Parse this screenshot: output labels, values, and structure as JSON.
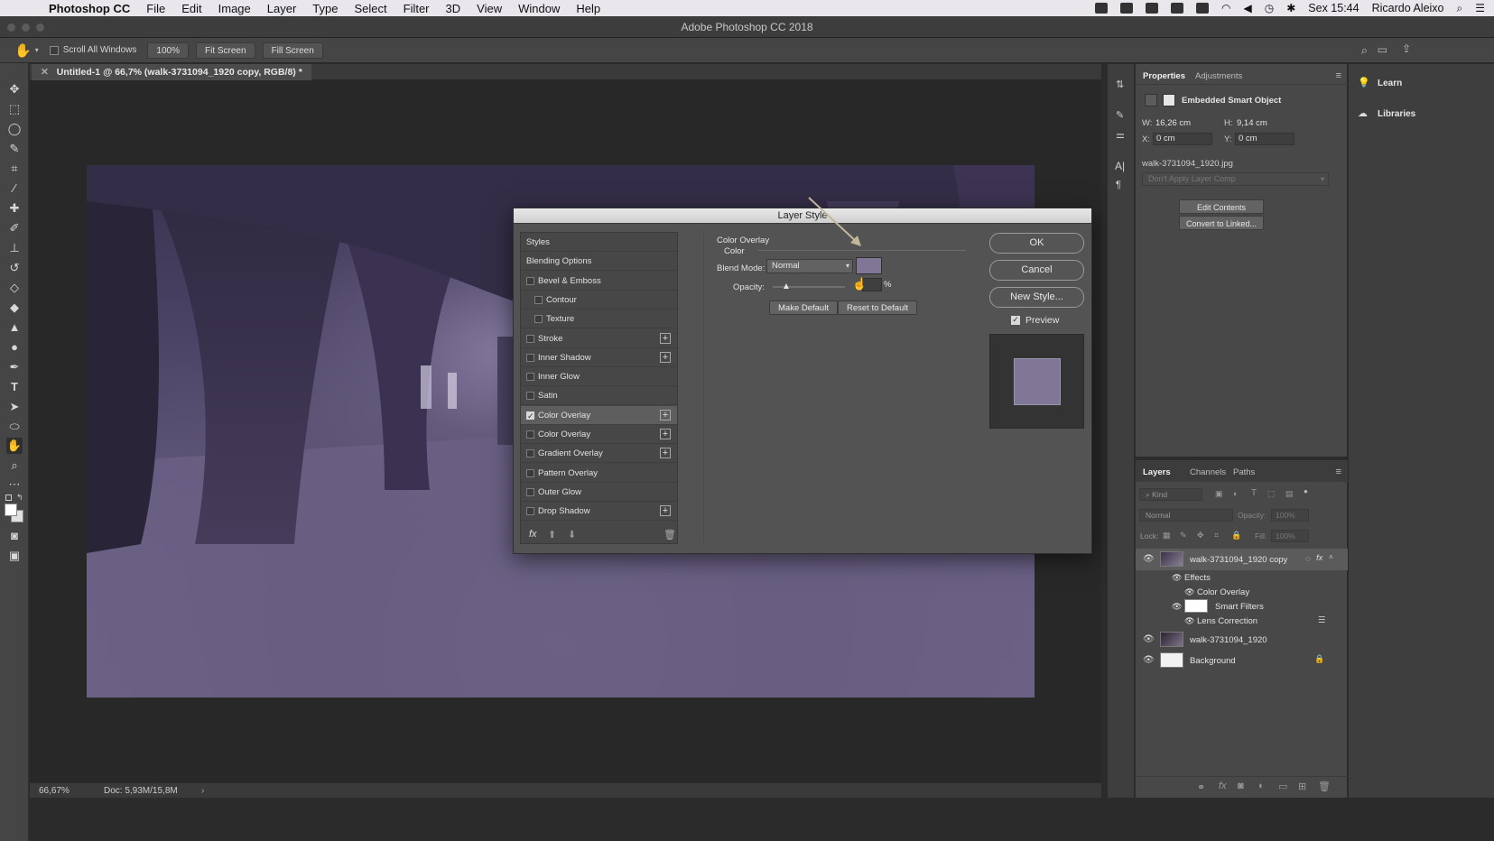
{
  "menubar": {
    "app_name": "Photoshop CC",
    "menus": [
      "File",
      "Edit",
      "Image",
      "Layer",
      "Type",
      "Select",
      "Filter",
      "3D",
      "View",
      "Window",
      "Help"
    ],
    "clock": "Sex 15:44",
    "user": "Ricardo Aleixo"
  },
  "window": {
    "title": "Adobe Photoshop CC 2018"
  },
  "options": {
    "scroll_all_label": "Scroll All Windows",
    "zoom_btn": "100%",
    "fit_screen": "Fit Screen",
    "fill_screen": "Fill Screen"
  },
  "document": {
    "tab_title": "Untitled-1 @ 66,7% (walk-3731094_1920 copy, RGB/8) *",
    "zoom": "66,67%",
    "doc_size": "Doc: 5,93M/15,8M"
  },
  "dialog": {
    "title": "Layer Style",
    "styles": [
      {
        "label": "Styles",
        "type": "header"
      },
      {
        "label": "Blending Options",
        "type": "header"
      },
      {
        "label": "Bevel & Emboss",
        "checked": false
      },
      {
        "label": "Contour",
        "checked": false,
        "indent": true
      },
      {
        "label": "Texture",
        "checked": false,
        "indent": true
      },
      {
        "label": "Stroke",
        "checked": false,
        "plus": true
      },
      {
        "label": "Inner Shadow",
        "checked": false,
        "plus": true
      },
      {
        "label": "Inner Glow",
        "checked": false
      },
      {
        "label": "Satin",
        "checked": false
      },
      {
        "label": "Color Overlay",
        "checked": true,
        "plus": true,
        "selected": true
      },
      {
        "label": "Color Overlay",
        "checked": false,
        "plus": true
      },
      {
        "label": "Gradient Overlay",
        "checked": false,
        "plus": true
      },
      {
        "label": "Pattern Overlay",
        "checked": false
      },
      {
        "label": "Outer Glow",
        "checked": false
      },
      {
        "label": "Drop Shadow",
        "checked": false,
        "plus": true
      }
    ],
    "footer_fx": "fx",
    "section_title": "Color Overlay",
    "section_sub": "Color",
    "blend_mode_label": "Blend Mode:",
    "blend_mode_value": "Normal",
    "overlay_color": "#7f7795",
    "opacity_label": "Opacity:",
    "opacity_unit": "%",
    "make_default": "Make Default",
    "reset_default": "Reset to Default",
    "ok": "OK",
    "cancel": "Cancel",
    "new_style": "New Style...",
    "preview_label": "Preview",
    "preview_checked": true
  },
  "properties": {
    "tab_properties": "Properties",
    "tab_adjustments": "Adjustments",
    "object_type": "Embedded Smart Object",
    "w_label": "W:",
    "w_value": "16,26 cm",
    "h_label": "H:",
    "h_value": "9,14 cm",
    "x_label": "X:",
    "x_value": "0 cm",
    "y_label": "Y:",
    "y_value": "0 cm",
    "filename": "walk-3731094_1920.jpg",
    "layer_comp": "Don't Apply Layer Comp",
    "edit_contents": "Edit Contents",
    "convert_linked": "Convert to Linked..."
  },
  "side_panel": {
    "learn": "Learn",
    "libraries": "Libraries"
  },
  "layers": {
    "tab_layers": "Layers",
    "tab_channels": "Channels",
    "tab_paths": "Paths",
    "kind": "Kind",
    "blend": "Normal",
    "opacity_label": "Opacity:",
    "opacity_value": "100%",
    "lock_label": "Lock:",
    "fill_label": "Fill:",
    "fill_value": "100%",
    "rows": {
      "layer1": "walk-3731094_1920 copy",
      "effects": "Effects",
      "color_overlay": "Color Overlay",
      "smart_filters": "Smart Filters",
      "lens_correction": "Lens Correction",
      "layer2": "walk-3731094_1920",
      "background": "Background"
    }
  }
}
